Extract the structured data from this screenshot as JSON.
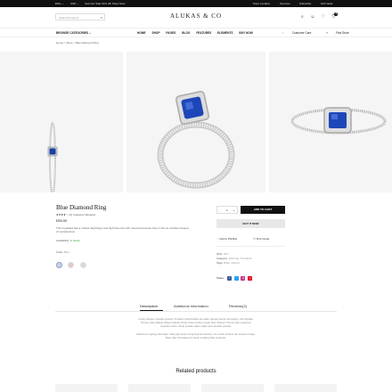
{
  "topbar": {
    "currency": "ENG ⌄",
    "lang": "USD ⌄",
    "promo": "Summer Sale 15% off! Shop Now!",
    "links": [
      "Store Location",
      "Services",
      "Subscribe",
      "Gift Cards"
    ]
  },
  "header": {
    "search_placeholder": "Search Products",
    "logo": "ALUKAS & CO",
    "cart_count": "0"
  },
  "nav": {
    "browse": "BROWSE CATEGORIES ⌄",
    "links": [
      "HOME",
      "SHOP",
      "PAGES",
      "BLOG",
      "FEATURES",
      "ELEMENTS",
      "BUY NOW"
    ],
    "right": [
      "Customer Care",
      "Find Store"
    ]
  },
  "breadcrumb": "Home > Shop > Blue Diamond Ring",
  "product": {
    "title": "Blue Diamond Ring",
    "rating_text": "(4) Customer Reviews",
    "stars": 4,
    "price": "£55.00",
    "description": "This regulated has a crafted diaphragm and high flow rate with reduced pressure drop it has an excellent degree of consideration.",
    "availability_label": "Availability:",
    "availability_value": "In Stock",
    "color_label": "Color:",
    "color_value": "Blue",
    "swatches": [
      "#c9d3e6",
      "#e2c9c4",
      "#d8d8d8"
    ],
    "qty_minus": "-",
    "qty_value": "1",
    "qty_plus": "+",
    "add_to_cart": "ADD TO CART",
    "buy_now": "BUY IT NOW",
    "wishlist": "Add to Wishlist",
    "size_guide": "Size Guide",
    "sku_label": "SKU:",
    "sku": "D57",
    "category_label": "Category:",
    "categories": "Earrings, Pendants",
    "tags_label": "Tags:",
    "tags": "Bride, Round",
    "share_label": "Share:"
  },
  "tabs": [
    "Description",
    "Additional Information",
    "Reviews(2)"
  ],
  "description_text": [
    "Candy dragee croissant dessert. Powder marshmallow pie wafer dessert sweet roll topping. Gif cupcake.",
    "Tart ice cake lollipop lollipop halvah chupa chups bonbon sugar plum dessert. Carrot cake macaroon",
    "cupcake cotton candy powder wafer sugar plum powder powder.",
    "Macaroon topping chocolate. Cake jelly beans icing tiramisu tiramisu. Ice cream bonbon tart sesame snaps.",
    "Bear claw chocolate bar candy pudding halls caramels."
  ],
  "related_title": "Related products",
  "icons": [
    "search-icon",
    "user-icon",
    "heart-icon",
    "cart-icon",
    "headset-icon",
    "pin-icon",
    "star-icon",
    "facebook-icon",
    "twitter-icon",
    "instagram-icon",
    "pinterest-icon"
  ]
}
